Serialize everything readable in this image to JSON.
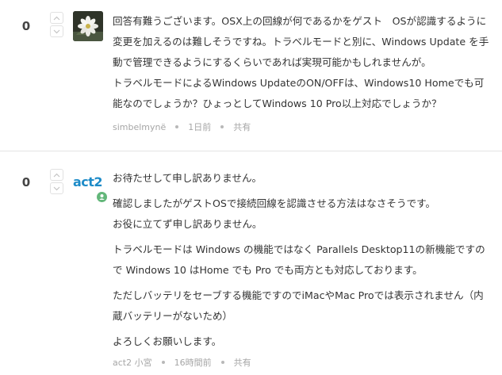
{
  "comments": [
    {
      "score": "0",
      "paragraphs": [
        "回答有難うございます。OSX上の回線が何であるかをゲスト　OSが認識するように変更を加えるのは難しそうですね。トラベルモードと別に、Windows Update を手動で管理できるようにするくらいであれば実現可能かもしれませんが。",
        "トラベルモードによるWindows UpdateのON/OFFは、Windows10 Homeでも可能なのでしょうか？ひょっとしてWindows 10 Pro以上対応でしょうか？"
      ],
      "author": "simbelmynë",
      "time": "1日前",
      "share_label": "共有"
    },
    {
      "score": "0",
      "logo_text": "act2",
      "paragraphs": [
        "お待たせして申し訳ありません。",
        "確認しましたがゲストOSで接続回線を認識させる方法はなさそうです。",
        "お役に立てず申し訳ありません。",
        "トラベルモードは Windows の機能ではなく Parallels Desktop11の新機能ですので Windows 10 はHome でも Pro でも両方とも対応しております。",
        "ただしバッテリをセーブする機能ですのでiMacやMac Proでは表示されません（内蔵バッテリーがないため）",
        "よろしくお願いします。"
      ],
      "author": "act2 小宮",
      "time": "16時間前",
      "share_label": "共有"
    }
  ],
  "colors": {
    "accent": "#1d8bc8",
    "badge": "#63b77a",
    "meta": "#a6a6a6"
  },
  "icons": {
    "vote_up": "chevron-up-icon",
    "vote_down": "chevron-down-icon",
    "avatar": "flower-avatar",
    "badge": "user-badge-icon"
  }
}
